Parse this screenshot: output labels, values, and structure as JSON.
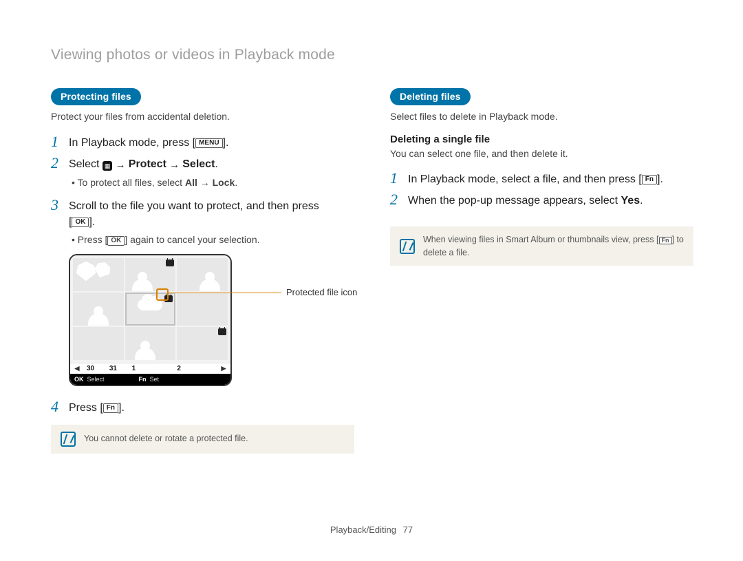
{
  "breadcrumb": "Viewing photos or videos in Playback mode",
  "left": {
    "pill": "Protecting files",
    "lead": "Protect your files from accidental deletion.",
    "step1": {
      "num": "1",
      "prefix": "In Playback mode, press [",
      "button": "MENU",
      "suffix": "]."
    },
    "step2": {
      "num": "2",
      "prefix": "Select ",
      "icon_label": "file-options-icon",
      "arrow": " → ",
      "b1": "Protect",
      "b2": "Select",
      "suffix": "."
    },
    "bullet1": {
      "prefix": "To protect all files, select ",
      "b1": "All",
      "arrow": " → ",
      "b2": "Lock",
      "suffix": "."
    },
    "step3": {
      "num": "3",
      "line1": "Scroll to the file you want to protect, and then press",
      "ok": "OK",
      "close": "[",
      "close2": "]."
    },
    "bullet2": {
      "prefix": "Press [",
      "ok": "OK",
      "suffix": "] again to cancel your selection."
    },
    "callout": "Protected file icon",
    "device": {
      "dates": [
        "30",
        "31",
        "1",
        "",
        "2",
        ""
      ],
      "bar": {
        "ok": "OK",
        "ok_label": "Select",
        "fn": "Fn",
        "fn_label": "Set"
      }
    },
    "step4": {
      "num": "4",
      "prefix": "Press [",
      "fn": "Fn",
      "suffix": "]."
    },
    "note": "You cannot delete or rotate a protected file."
  },
  "right": {
    "pill": "Deleting files",
    "lead": "Select files to delete in Playback mode.",
    "subheading": "Deleting a single file",
    "subtext": "You can select one file, and then delete it.",
    "step1": {
      "num": "1",
      "prefix": "In Playback mode, select a file, and then press [",
      "fn": "Fn",
      "suffix": "]."
    },
    "step2": {
      "num": "2",
      "prefix": "When the pop-up message appears, select ",
      "b1": "Yes",
      "suffix": "."
    },
    "note": {
      "prefix": "When viewing files in Smart Album or thumbnails view, press [",
      "fn": "Fn",
      "suffix": "] to delete a file."
    }
  },
  "footer": {
    "section": "Playback/Editing",
    "page": "77"
  }
}
